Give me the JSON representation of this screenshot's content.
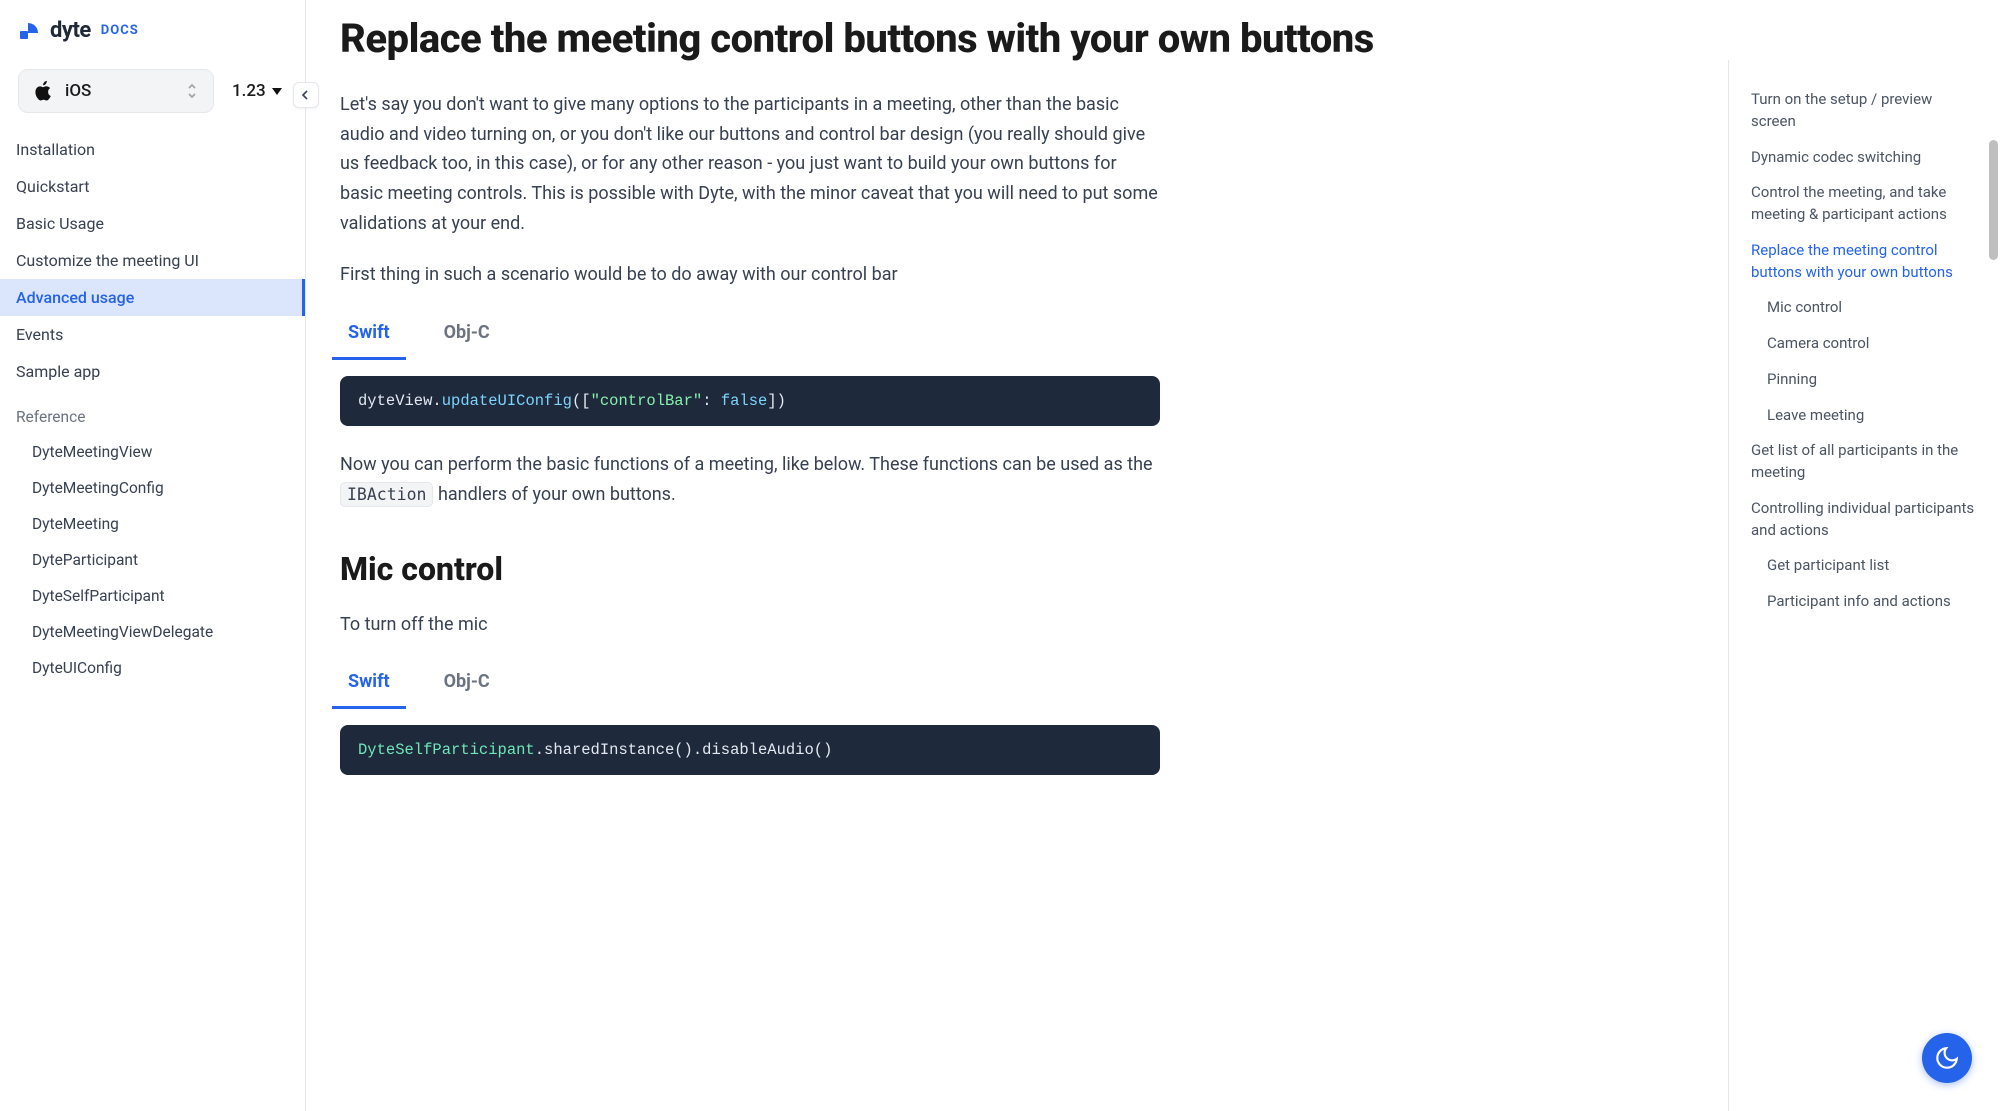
{
  "brand": {
    "name": "dyte",
    "docs_label": "DOCS"
  },
  "sidebar": {
    "platform": "iOS",
    "version": "1.23",
    "nav": [
      {
        "label": "Installation"
      },
      {
        "label": "Quickstart"
      },
      {
        "label": "Basic Usage"
      },
      {
        "label": "Customize the meeting UI"
      },
      {
        "label": "Advanced usage",
        "active": true
      },
      {
        "label": "Events"
      },
      {
        "label": "Sample app"
      }
    ],
    "reference_label": "Reference",
    "reference": [
      "DyteMeetingView",
      "DyteMeetingConfig",
      "DyteMeeting",
      "DyteParticipant",
      "DyteSelfParticipant",
      "DyteMeetingViewDelegate",
      "DyteUIConfig"
    ]
  },
  "content": {
    "title": "Replace the meeting control buttons with your own buttons",
    "para1": "Let's say you don't want to give many options to the participants in a meeting, other than the basic audio and video turning on, or you don't like our buttons and control bar design (you really should give us feedback too, in this case), or for any other reason - you just want to build your own buttons for basic meeting controls. This is possible with Dyte, with the minor caveat that you will need to put some validations at your end.",
    "para2": "First thing in such a scenario would be to do away with our control bar",
    "tabs": {
      "swift": "Swift",
      "objc": "Obj-C"
    },
    "code1": {
      "v": "dyteView",
      "dot1": ".",
      "fn": "updateUIConfig",
      "open": "([",
      "str": "\"controlBar\"",
      "colon": ": ",
      "val": "false",
      "close": "])"
    },
    "para3_a": "Now you can perform the basic functions of a meeting, like below. These functions can be used as the ",
    "para3_code": "IBAction",
    "para3_b": " handlers of your own buttons.",
    "mic_title": "Mic control",
    "mic_para": "To turn off the mic",
    "code2": {
      "type": "DyteSelfParticipant",
      "rest": ".sharedInstance().disableAudio()"
    }
  },
  "toc": [
    {
      "label": "Turn on the setup / preview screen"
    },
    {
      "label": "Dynamic codec switching"
    },
    {
      "label": "Control the meeting, and take meeting & participant actions"
    },
    {
      "label": "Replace the meeting control buttons with your own buttons",
      "active": true
    },
    {
      "label": "Mic control",
      "sub": true
    },
    {
      "label": "Camera control",
      "sub": true
    },
    {
      "label": "Pinning",
      "sub": true
    },
    {
      "label": "Leave meeting",
      "sub": true
    },
    {
      "label": "Get list of all participants in the meeting"
    },
    {
      "label": "Controlling individual participants and actions"
    },
    {
      "label": "Get participant list",
      "sub": true
    },
    {
      "label": "Participant info and actions",
      "sub": true
    }
  ]
}
